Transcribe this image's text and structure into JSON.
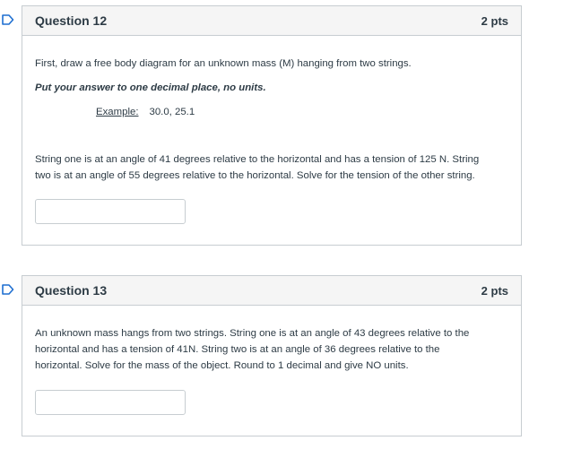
{
  "colors": {
    "flag_outline": "#1f6fd1",
    "header_background": "#f5f5f5",
    "border": "#c7cdd1",
    "text": "#2d3b45"
  },
  "questions": [
    {
      "flag_icon": "bookmark-flag-icon",
      "title": "Question 12",
      "points": "2 pts",
      "intro": "First, draw a free body diagram for an unknown mass (M) hanging from two strings.",
      "instruction": "Put your answer to one decimal place, no units.",
      "example_label": "Example:",
      "example_value": "30.0, 25.1",
      "text_line1": "String one is at an angle of 41 degrees relative to the horizontal and has a tension of 125 N. String",
      "text_line2": "two is at an angle of 55 degrees relative to the horizontal. Solve for the tension of the other string.",
      "answer_value": ""
    },
    {
      "flag_icon": "bookmark-flag-icon",
      "title": "Question 13",
      "points": "2 pts",
      "text_line1": "An unknown mass hangs from two strings. String one is at an angle of 43 degrees relative to the",
      "text_line2": "horizontal and has a tension of 41N. String two is at an angle of 36 degrees relative to the",
      "text_line3": "horizontal. Solve for the mass of the object. Round to 1 decimal and give NO units.",
      "answer_value": ""
    }
  ]
}
